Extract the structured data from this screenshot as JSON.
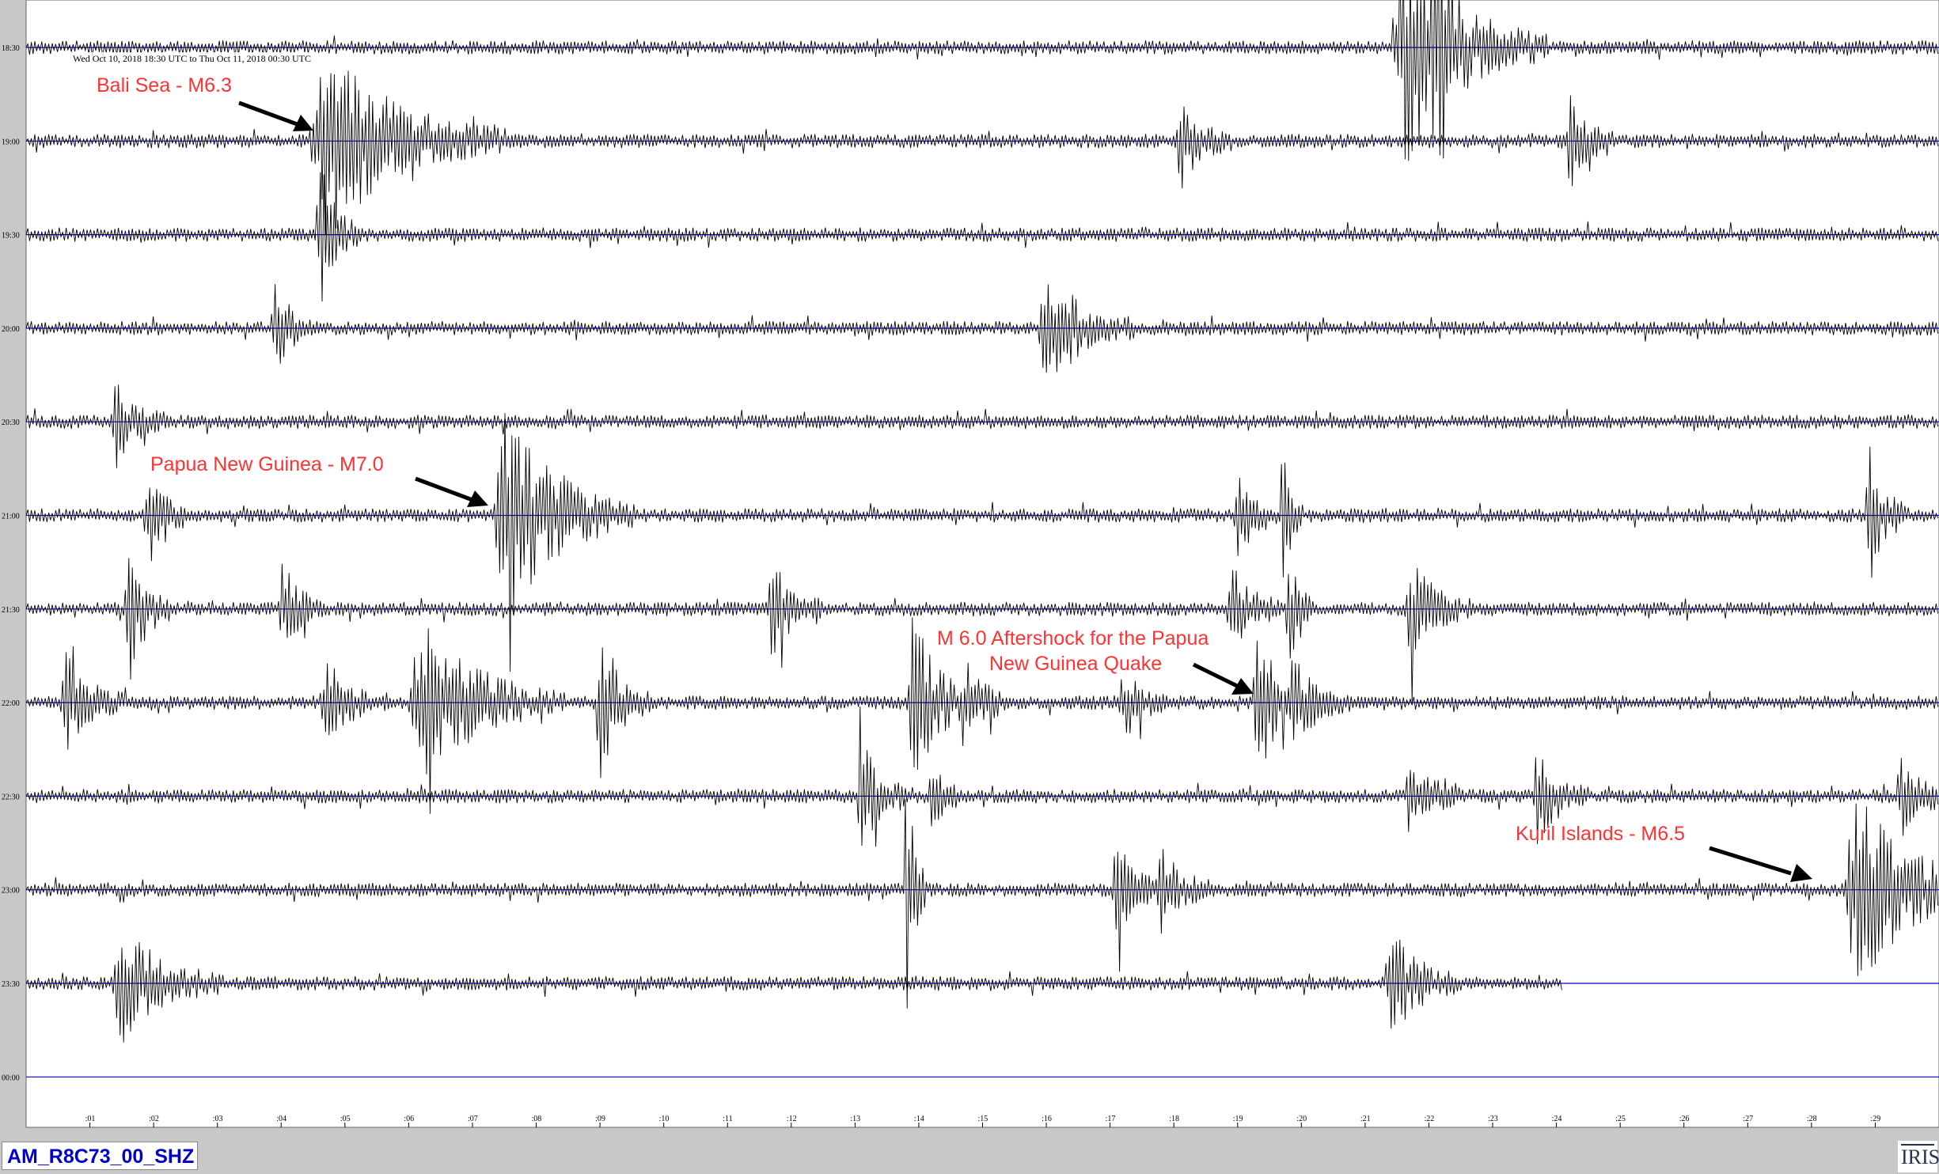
{
  "header": {
    "time_range": "Wed Oct 10, 2018 18:30 UTC to Thu Oct 11, 2018 00:30 UTC"
  },
  "station_label": "AM_R8C73_00_SHZ",
  "logo_text": "IRIS",
  "colors": {
    "trace": "#000000",
    "baseline": "#0000cc",
    "annotation": "#ff3333",
    "arrow": "#000000",
    "plot_background": "#ffffff",
    "frame_background": "#c8c8c8"
  },
  "chart_data": {
    "type": "line",
    "description_type": "helicorder",
    "title": "",
    "xlabel": "",
    "ylabel": "",
    "x_unit": "minutes past the row start",
    "x_range": [
      0,
      30
    ],
    "x_tick_labels": [
      ":01",
      ":02",
      ":03",
      ":04",
      ":05",
      ":06",
      ":07",
      ":08",
      ":09",
      ":10",
      ":11",
      ":12",
      ":13",
      ":14",
      ":15",
      ":16",
      ":17",
      ":18",
      ":19",
      ":20",
      ":21",
      ":22",
      ":23",
      ":24",
      ":25",
      ":26",
      ":27",
      ":28",
      ":29"
    ],
    "rows": [
      {
        "label": "18:30",
        "data_end_min": 30,
        "bursts": [
          {
            "t": 21.6,
            "amp": 3.2,
            "dur": 1.4
          },
          {
            "t": 22.1,
            "amp": 4.5,
            "dur": 0.5
          }
        ]
      },
      {
        "label": "19:00",
        "data_end_min": 30,
        "bursts": [
          {
            "t": 4.7,
            "amp": 2.6,
            "dur": 1.8
          },
          {
            "t": 18.1,
            "amp": 1.4,
            "dur": 0.5
          },
          {
            "t": 24.2,
            "amp": 1.6,
            "dur": 0.4
          }
        ]
      },
      {
        "label": "19:30",
        "data_end_min": 30,
        "bursts": [
          {
            "t": 4.6,
            "amp": 2.0,
            "dur": 0.4
          }
        ]
      },
      {
        "label": "20:00",
        "data_end_min": 30,
        "bursts": [
          {
            "t": 3.9,
            "amp": 1.5,
            "dur": 0.4
          },
          {
            "t": 16.0,
            "amp": 1.7,
            "dur": 0.9
          }
        ]
      },
      {
        "label": "20:30",
        "data_end_min": 30,
        "bursts": [
          {
            "t": 1.4,
            "amp": 1.3,
            "dur": 0.5
          }
        ]
      },
      {
        "label": "21:00",
        "data_end_min": 30,
        "bursts": [
          {
            "t": 1.9,
            "amp": 1.4,
            "dur": 0.4
          },
          {
            "t": 7.5,
            "amp": 3.0,
            "dur": 1.3
          },
          {
            "t": 19.0,
            "amp": 1.4,
            "dur": 0.4
          },
          {
            "t": 19.7,
            "amp": 2.2,
            "dur": 0.2
          },
          {
            "t": 28.9,
            "amp": 1.9,
            "dur": 0.4
          }
        ]
      },
      {
        "label": "21:30",
        "data_end_min": 30,
        "bursts": [
          {
            "t": 1.6,
            "amp": 2.1,
            "dur": 0.4
          },
          {
            "t": 4.0,
            "amp": 1.5,
            "dur": 0.4
          },
          {
            "t": 11.7,
            "amp": 1.4,
            "dur": 0.5
          },
          {
            "t": 18.9,
            "amp": 1.4,
            "dur": 0.5
          },
          {
            "t": 19.8,
            "amp": 1.8,
            "dur": 0.3
          },
          {
            "t": 21.7,
            "amp": 1.5,
            "dur": 0.6
          }
        ]
      },
      {
        "label": "22:00",
        "data_end_min": 30,
        "bursts": [
          {
            "t": 0.6,
            "amp": 1.4,
            "dur": 0.6
          },
          {
            "t": 4.7,
            "amp": 1.4,
            "dur": 0.6
          },
          {
            "t": 6.2,
            "amp": 2.3,
            "dur": 1.4
          },
          {
            "t": 9.0,
            "amp": 2.2,
            "dur": 0.5
          },
          {
            "t": 13.9,
            "amp": 2.6,
            "dur": 0.6
          },
          {
            "t": 14.7,
            "amp": 1.3,
            "dur": 0.5
          },
          {
            "t": 17.2,
            "amp": 1.2,
            "dur": 0.4
          },
          {
            "t": 19.3,
            "amp": 2.2,
            "dur": 0.5
          },
          {
            "t": 19.8,
            "amp": 1.5,
            "dur": 0.6
          }
        ]
      },
      {
        "label": "22:30",
        "data_end_min": 30,
        "bursts": [
          {
            "t": 13.1,
            "amp": 1.6,
            "dur": 0.5
          },
          {
            "t": 14.2,
            "amp": 1.2,
            "dur": 0.3
          },
          {
            "t": 21.7,
            "amp": 1.3,
            "dur": 0.5
          },
          {
            "t": 23.7,
            "amp": 1.4,
            "dur": 0.5
          },
          {
            "t": 29.4,
            "amp": 1.2,
            "dur": 0.5
          }
        ]
      },
      {
        "label": "23:00",
        "data_end_min": 30,
        "bursts": [
          {
            "t": 13.8,
            "amp": 3.7,
            "dur": 0.2
          },
          {
            "t": 17.1,
            "amp": 1.3,
            "dur": 0.6
          },
          {
            "t": 17.8,
            "amp": 1.2,
            "dur": 0.6
          },
          {
            "t": 28.7,
            "amp": 3.0,
            "dur": 1.3
          }
        ]
      },
      {
        "label": "23:30",
        "data_end_min": 24.1,
        "bursts": [
          {
            "t": 1.5,
            "amp": 1.7,
            "dur": 1.0
          },
          {
            "t": 21.4,
            "amp": 1.5,
            "dur": 0.7
          }
        ]
      },
      {
        "label": "00:00",
        "data_end_min": 0,
        "bursts": []
      }
    ],
    "annotations": [
      {
        "text": "Bali Sea - M6.3",
        "row_label": "19:00",
        "t": 4.7
      },
      {
        "text": "Papua New Guinea - M7.0",
        "row_label": "21:00",
        "t": 7.4
      },
      {
        "text": "M 6.0 Aftershock for the Papua New Guinea Quake",
        "row_label": "22:00",
        "t": 19.3
      },
      {
        "text": "Kuril Islands - M6.5",
        "row_label": "23:00",
        "t": 28.1
      }
    ]
  }
}
